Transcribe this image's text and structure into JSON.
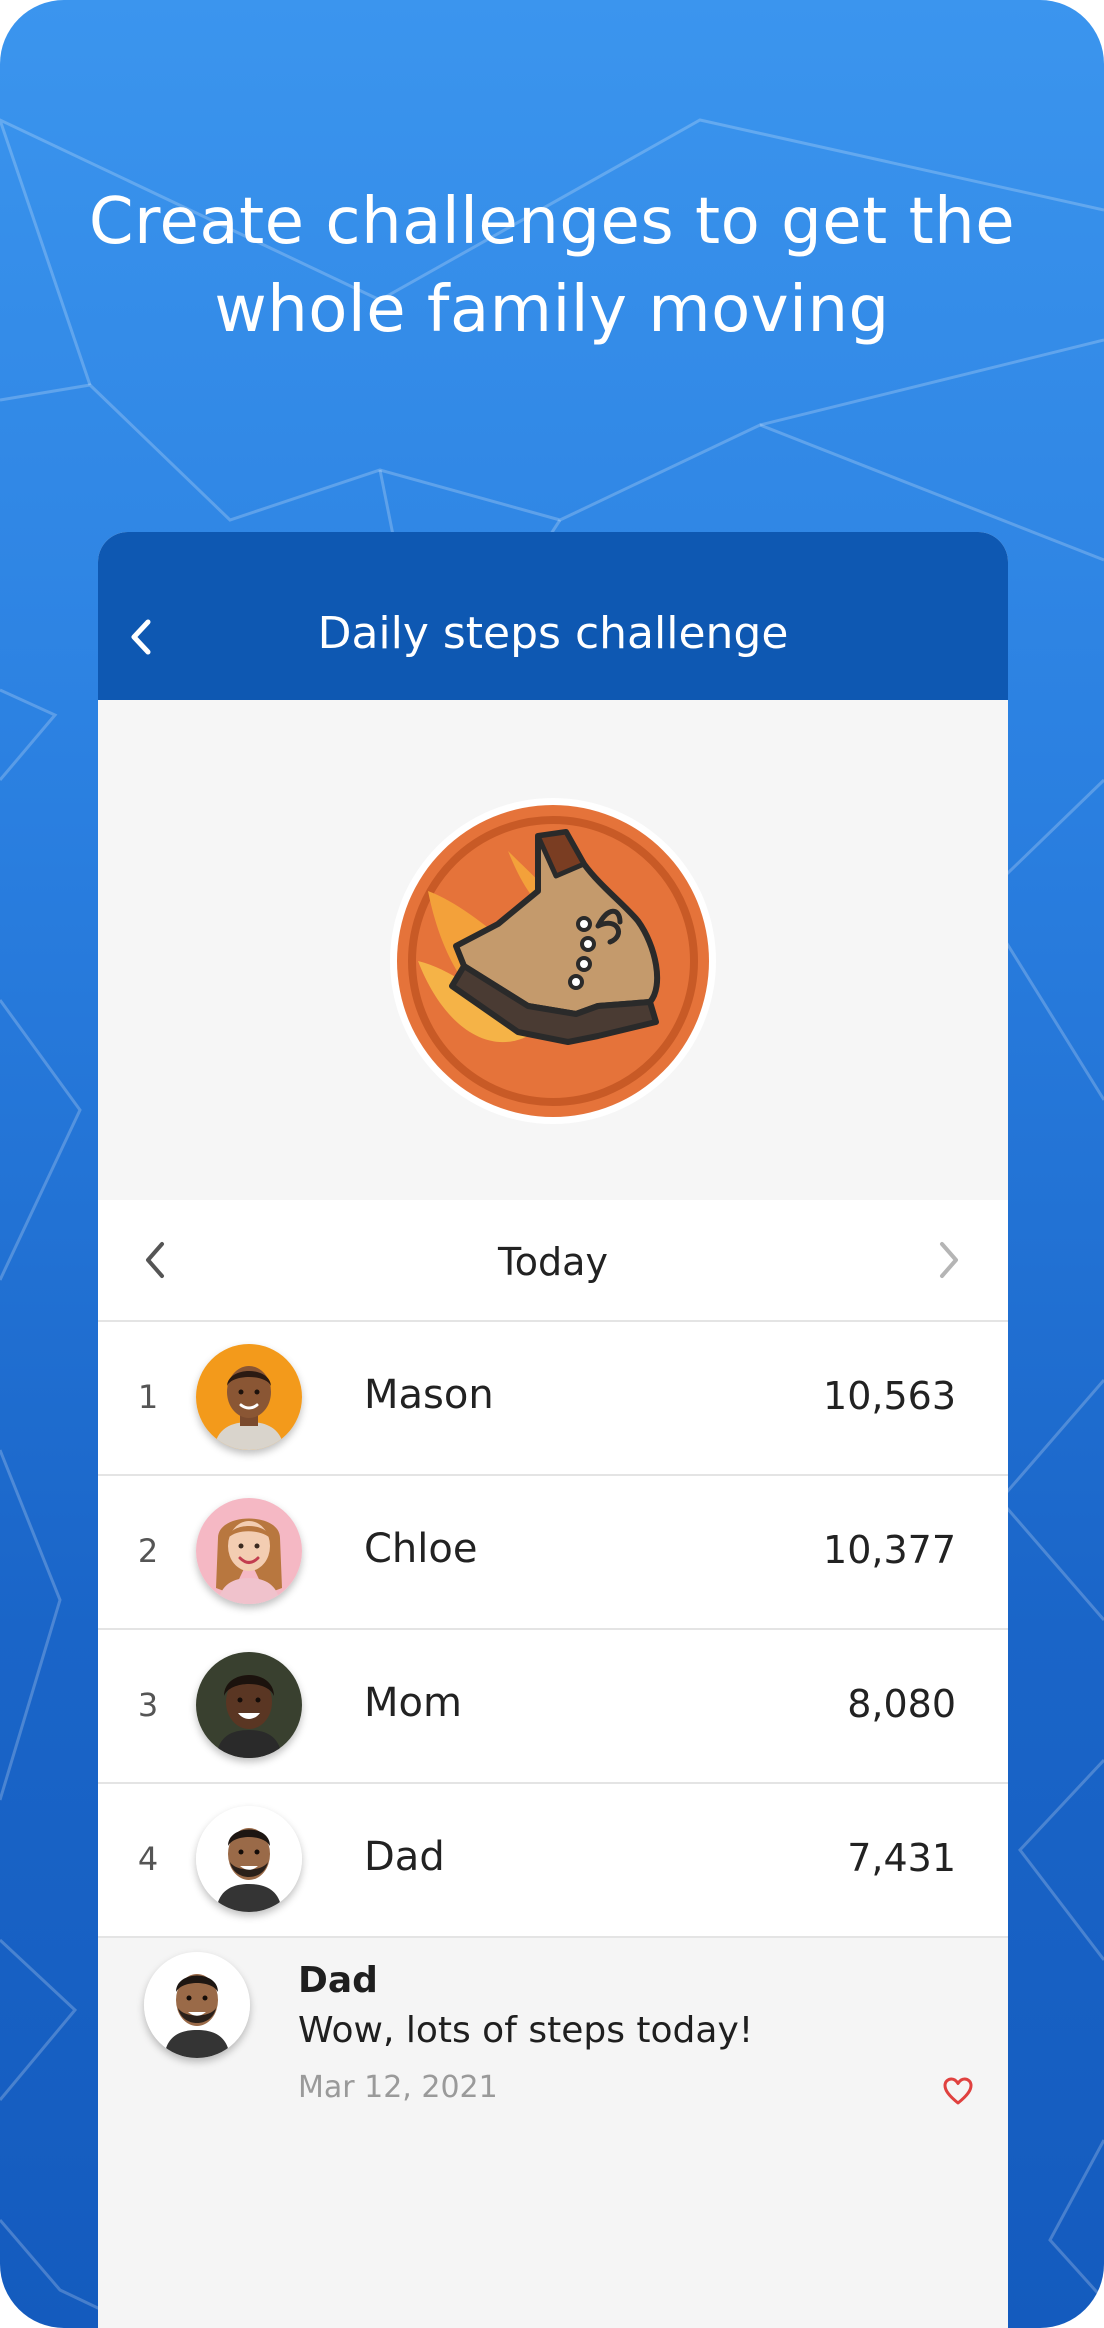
{
  "headline": "Create challenges to get the whole family moving",
  "app_bar": {
    "title": "Daily steps challenge",
    "back_icon": "chevron-left-icon"
  },
  "badge": {
    "icon": "flaming-boot-icon"
  },
  "day_nav": {
    "label": "Today",
    "prev_icon": "chevron-left-icon",
    "next_icon": "chevron-right-icon"
  },
  "leaderboard": [
    {
      "rank": "1",
      "name": "Mason",
      "steps": "10,563",
      "avatar": "mason-avatar"
    },
    {
      "rank": "2",
      "name": "Chloe",
      "steps": "10,377",
      "avatar": "chloe-avatar"
    },
    {
      "rank": "3",
      "name": "Mom",
      "steps": "8,080",
      "avatar": "mom-avatar"
    },
    {
      "rank": "4",
      "name": "Dad",
      "steps": "7,431",
      "avatar": "dad-avatar"
    }
  ],
  "comment": {
    "author": "Dad",
    "text": "Wow, lots of steps today!",
    "date": "Mar 12, 2021",
    "like_icon": "heart-icon"
  },
  "colors": {
    "background_top": "#3b95ee",
    "background_bottom": "#145bbe",
    "app_bar": "#0e58b2",
    "badge_orange": "#e5733a",
    "heart": "#e0413f"
  }
}
